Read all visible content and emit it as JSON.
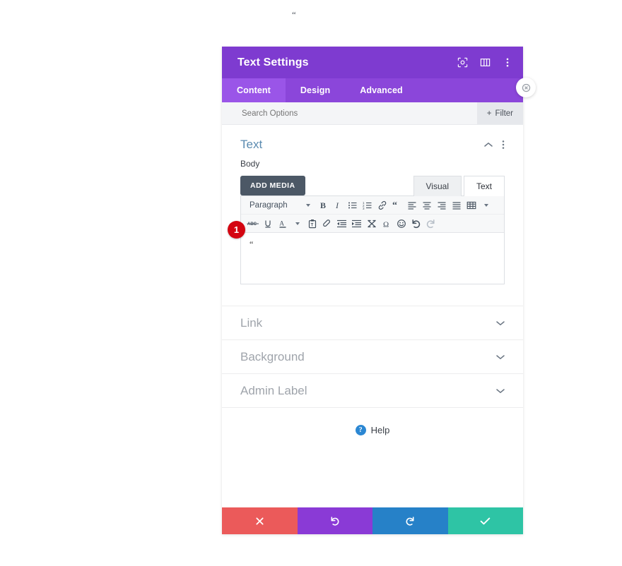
{
  "page": {
    "stray_quote": "“"
  },
  "header": {
    "title": "Text Settings",
    "icons": [
      {
        "name": "focus-icon",
        "glyph": "focus"
      },
      {
        "name": "layout-columns-icon",
        "glyph": "columns"
      },
      {
        "name": "more-vertical-icon",
        "glyph": "dots"
      }
    ]
  },
  "tabs": [
    {
      "label": "Content",
      "active": true
    },
    {
      "label": "Design",
      "active": false
    },
    {
      "label": "Advanced",
      "active": false
    }
  ],
  "search": {
    "placeholder": "Search Options",
    "value": "",
    "filter_label": "Filter",
    "filter_plus": "+"
  },
  "text_section": {
    "title": "Text",
    "collapse_icon": "chevron-up-icon",
    "menu_icon": "more-vertical-icon",
    "field_label": "Body",
    "add_media_label": "ADD MEDIA",
    "editor_tabs": [
      {
        "label": "Visual",
        "active": false
      },
      {
        "label": "Text",
        "active": true
      }
    ],
    "toolbar_row1": {
      "format_select": "Paragraph",
      "buttons": [
        "bold-icon",
        "italic-icon",
        "bulleted-list-icon",
        "numbered-list-icon",
        "link-icon",
        "blockquote-icon",
        "align-left-icon",
        "align-center-icon",
        "align-right-icon",
        "align-justify-icon",
        "table-icon",
        "table-dropdown-icon"
      ]
    },
    "toolbar_row2": {
      "buttons": [
        "strikethrough-icon",
        "underline-icon",
        "text-color-icon",
        "text-color-dropdown-icon",
        "paste-as-text-icon",
        "clear-formatting-icon",
        "decrease-indent-icon",
        "increase-indent-icon",
        "insert-more-icon",
        "special-character-icon",
        "emoji-icon",
        "undo-icon",
        "redo-icon"
      ]
    },
    "editor_body": "“"
  },
  "badge": {
    "label": "1",
    "color": "#d40511"
  },
  "collapsed_sections": [
    {
      "title": "Link",
      "icon": "chevron-down-icon"
    },
    {
      "title": "Background",
      "icon": "chevron-down-icon"
    },
    {
      "title": "Admin Label",
      "icon": "chevron-down-icon"
    }
  ],
  "help": {
    "label": "Help",
    "icon_glyph": "?"
  },
  "footer": {
    "buttons": [
      {
        "name": "cancel-button",
        "glyph": "✖",
        "color": "#eb5a5a"
      },
      {
        "name": "undo-button",
        "glyph": "undo",
        "color": "#8a3ad6"
      },
      {
        "name": "redo-button",
        "glyph": "redo",
        "color": "#2681c8"
      },
      {
        "name": "save-button",
        "glyph": "✔",
        "color": "#2ec4a5"
      }
    ]
  },
  "floating_close": {
    "name": "close-settings-button"
  }
}
